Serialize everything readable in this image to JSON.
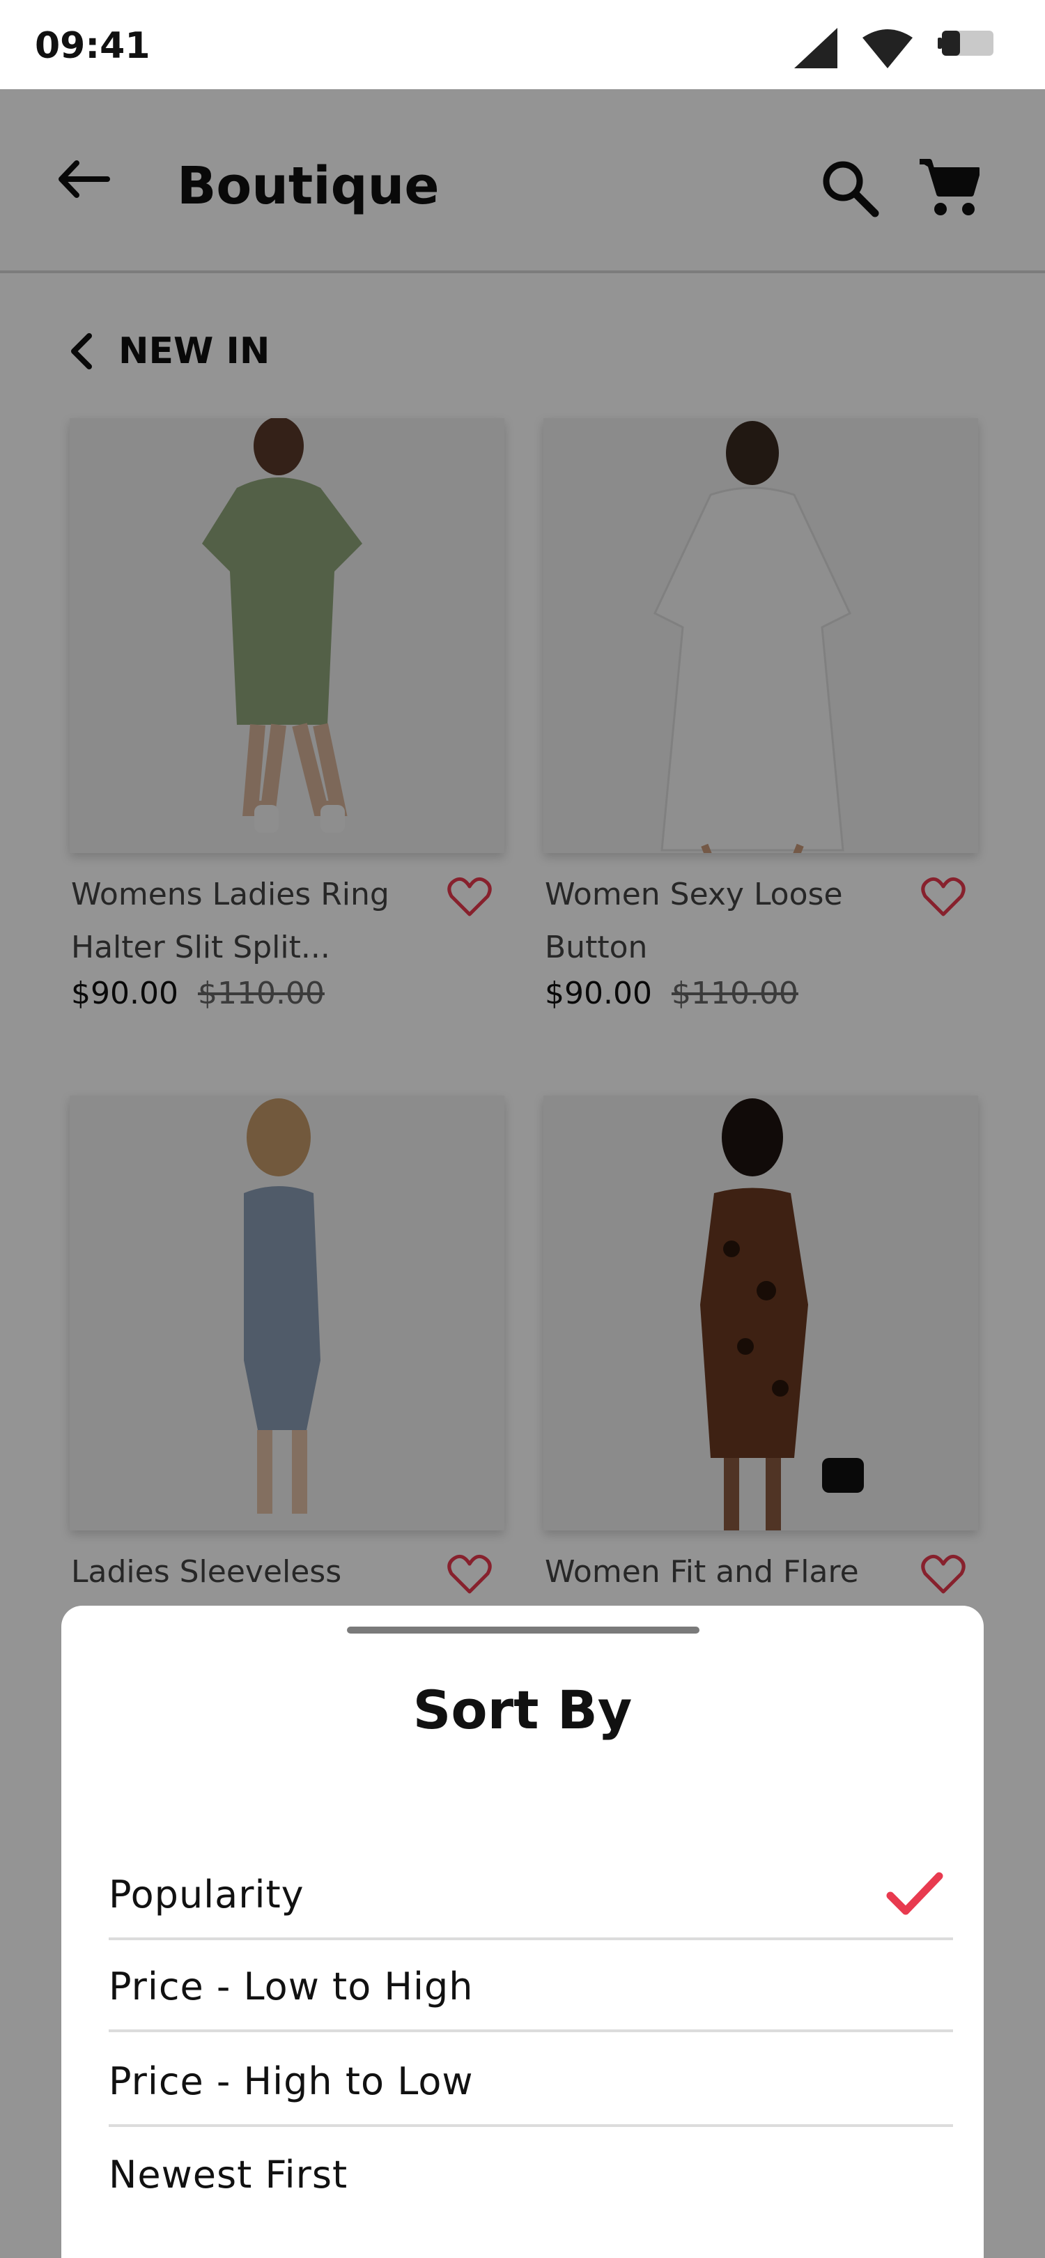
{
  "status_bar": {
    "time": "09:41",
    "icons": [
      "signal-icon",
      "wifi-icon",
      "battery-icon"
    ]
  },
  "app_bar": {
    "title": "Boutique",
    "icons": [
      "back-arrow-icon",
      "search-icon",
      "cart-icon"
    ]
  },
  "section": {
    "title": "NEW IN"
  },
  "products": [
    {
      "name": "Womens Ladies Ring Halter Slit Split...",
      "price": "$90.00",
      "old_price": "$110.00",
      "dress_color": "#8fa67a"
    },
    {
      "name": "Women Sexy Loose Button",
      "price": "$90.00",
      "old_price": "$110.00",
      "dress_color": "#f1f1f1"
    },
    {
      "name": "Ladies Sleeveless Cotton",
      "price": "",
      "old_price": "",
      "dress_color": "#8a9db5"
    },
    {
      "name": "Women Fit and Flare",
      "price": "",
      "old_price": "",
      "dress_color": "#6b3a22"
    }
  ],
  "sort_sheet": {
    "title": "Sort By",
    "options": [
      {
        "label": "Popularity",
        "selected": true
      },
      {
        "label": "Price - Low to High",
        "selected": false
      },
      {
        "label": "Price - High to Low",
        "selected": false
      },
      {
        "label": "Newest First",
        "selected": false
      }
    ]
  },
  "colors": {
    "accent": "#e83a4f",
    "overlay": "#000000",
    "text": "#111111"
  }
}
